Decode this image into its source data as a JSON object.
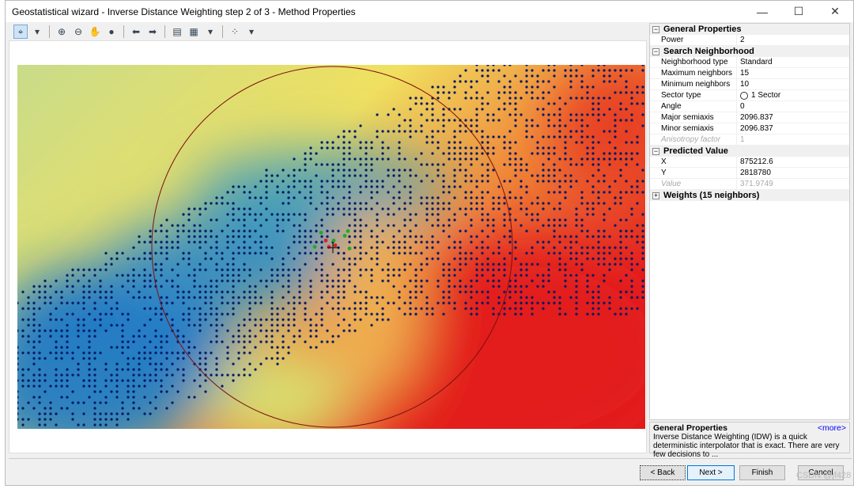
{
  "window": {
    "title": "Geostatistical wizard - Inverse Distance Weighting step 2 of 3 - Method Properties",
    "minimize": "—",
    "maximize": "☐",
    "close": "✕"
  },
  "toolbar": {
    "tools": [
      {
        "name": "select-tool",
        "icon": "⌖"
      },
      {
        "name": "dropdown",
        "icon": "▾"
      },
      {
        "name": "zoom-in",
        "icon": "⊕"
      },
      {
        "name": "zoom-out",
        "icon": "⊖"
      },
      {
        "name": "pan",
        "icon": "✋"
      },
      {
        "name": "full-extent",
        "icon": "●"
      },
      {
        "name": "back-extent",
        "icon": "⬅"
      },
      {
        "name": "forward-extent",
        "icon": "➡"
      },
      {
        "name": "table",
        "icon": "▤"
      },
      {
        "name": "layer",
        "icon": "▦"
      },
      {
        "name": "layer-dropdown",
        "icon": "▾"
      },
      {
        "name": "points",
        "icon": "⁘"
      },
      {
        "name": "points-dropdown",
        "icon": "▾"
      }
    ]
  },
  "map": {
    "colors": {
      "low": "#1f78c8",
      "mid": "#f0e878",
      "high": "#e31a1c",
      "points": "#001a66",
      "neighbors": "#22aa22",
      "selected": "#dd2222",
      "circle": "#7a1010"
    }
  },
  "properties": {
    "general": {
      "title": "General Properties",
      "rows": [
        {
          "k": "Power",
          "v": "2"
        }
      ]
    },
    "search": {
      "title": "Search Neighborhood",
      "rows": [
        {
          "k": "Neighborhood type",
          "v": "Standard"
        },
        {
          "k": "Maximum neighbors",
          "v": "15"
        },
        {
          "k": "Minimum neighbors",
          "v": "10"
        },
        {
          "k": "Sector type",
          "v": "1 Sector"
        },
        {
          "k": "Angle",
          "v": "0"
        },
        {
          "k": "Major semiaxis",
          "v": "2096.837"
        },
        {
          "k": "Minor semiaxis",
          "v": "2096.837"
        },
        {
          "k": "Anisotropy factor",
          "v": "1"
        }
      ]
    },
    "predicted": {
      "title": "Predicted Value",
      "rows": [
        {
          "k": "X",
          "v": "875212.6"
        },
        {
          "k": "Y",
          "v": "2818780"
        },
        {
          "k": "Value",
          "v": "371.9749"
        }
      ]
    },
    "weights": {
      "title": "Weights (15 neighbors)"
    }
  },
  "description": {
    "title": "General Properties",
    "more": "<more>",
    "text": "Inverse Distance Weighting (IDW) is a quick deterministic interpolator that is exact. There are very few decisions to ..."
  },
  "buttons": {
    "back": "< Back",
    "next": "Next >",
    "finish": "Finish",
    "cancel": "Cancel"
  },
  "watermark": "CSDN @jf428"
}
